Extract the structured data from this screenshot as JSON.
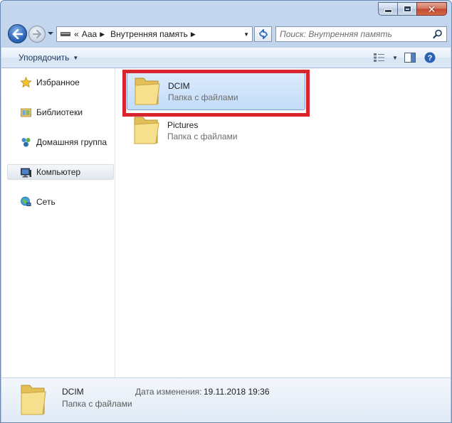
{
  "window": {
    "minimize_icon": "minimize-icon",
    "maximize_icon": "maximize-icon",
    "close_glyph": "✕"
  },
  "address": {
    "overflow": "«",
    "segments": [
      "Ааа",
      "Внутренняя память"
    ],
    "search_placeholder": "Поиск: Внутренняя память"
  },
  "toolbar": {
    "organize_label": "Упорядочить"
  },
  "nav_pane": {
    "items": [
      {
        "label": "Избранное",
        "icon": "star-icon"
      },
      {
        "label": "Библиотеки",
        "icon": "libraries-icon"
      },
      {
        "label": "Домашняя группа",
        "icon": "homegroup-icon"
      },
      {
        "label": "Компьютер",
        "icon": "computer-icon",
        "selected": true
      },
      {
        "label": "Сеть",
        "icon": "network-icon"
      }
    ]
  },
  "files": [
    {
      "name": "DCIM",
      "type": "Папка с файлами",
      "selected": true
    },
    {
      "name": "Pictures",
      "type": "Папка с файлами",
      "selected": false
    }
  ],
  "details": {
    "name": "DCIM",
    "type": "Папка с файлами",
    "date_label": "Дата изменения:",
    "date_value": "19.11.2018 19:36"
  },
  "colors": {
    "highlight": "#d9242d",
    "selection": "#c3dcf8",
    "toolbar_text": "#1e395b"
  }
}
